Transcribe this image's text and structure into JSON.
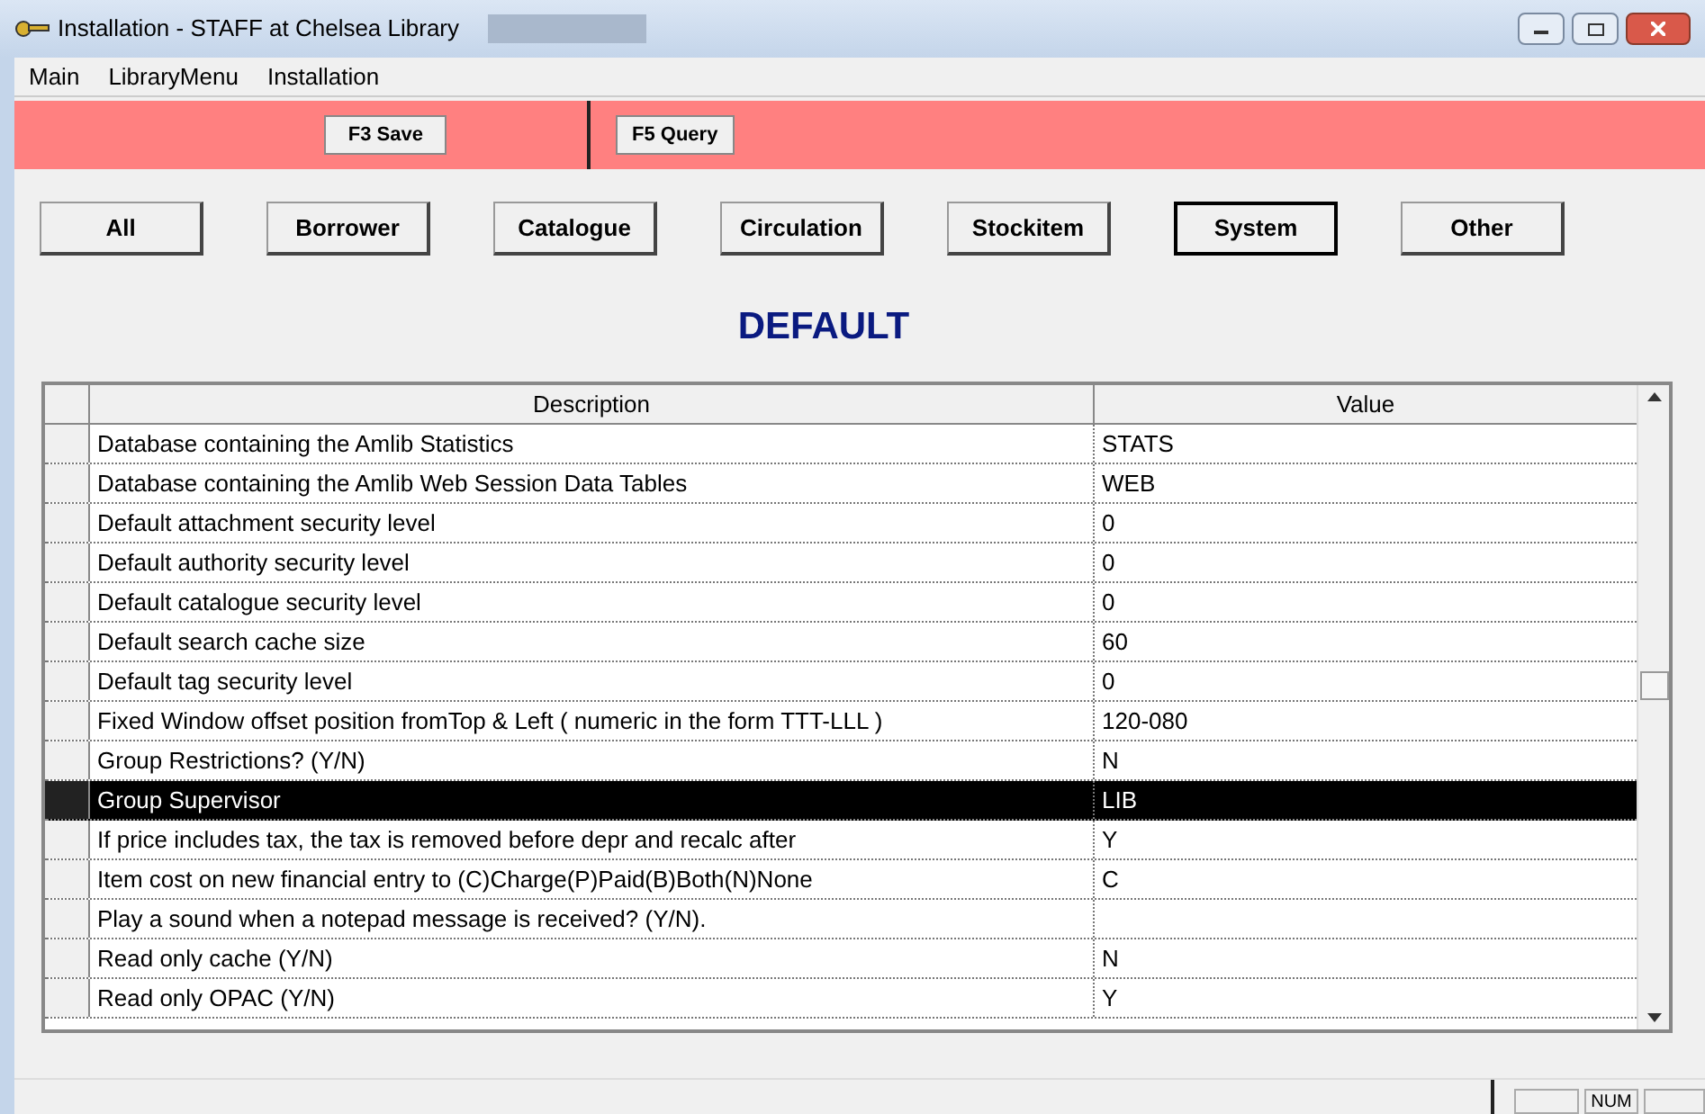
{
  "window": {
    "title": "Installation - STAFF at Chelsea Library"
  },
  "menu": [
    "Main",
    "LibraryMenu",
    "Installation"
  ],
  "toolbar": [
    "F3 Save",
    "F5 Query"
  ],
  "categories": [
    {
      "label": "All",
      "selected": false
    },
    {
      "label": "Borrower",
      "selected": false
    },
    {
      "label": "Catalogue",
      "selected": false
    },
    {
      "label": "Circulation",
      "selected": false
    },
    {
      "label": "Stockitem",
      "selected": false
    },
    {
      "label": "System",
      "selected": true
    },
    {
      "label": "Other",
      "selected": false
    }
  ],
  "heading": "DEFAULT",
  "table": {
    "columns": [
      "Description",
      "Value"
    ],
    "rows": [
      {
        "description": "Database containing the Amlib Statistics",
        "value": "STATS",
        "selected": false
      },
      {
        "description": "Database containing the Amlib Web Session Data Tables",
        "value": "WEB",
        "selected": false
      },
      {
        "description": "Default attachment security level",
        "value": "0",
        "selected": false
      },
      {
        "description": "Default authority security level",
        "value": "0",
        "selected": false
      },
      {
        "description": "Default catalogue security level",
        "value": "0",
        "selected": false
      },
      {
        "description": "Default search cache size",
        "value": "60",
        "selected": false
      },
      {
        "description": "Default tag security level",
        "value": "0",
        "selected": false
      },
      {
        "description": "Fixed Window offset position fromTop & Left ( numeric in the form TTT-LLL )",
        "value": "120-080",
        "selected": false
      },
      {
        "description": "Group Restrictions? (Y/N)",
        "value": "N",
        "selected": false
      },
      {
        "description": "Group Supervisor",
        "value": "LIB",
        "selected": true
      },
      {
        "description": "If price includes tax, the tax is removed before depr and recalc after",
        "value": "Y",
        "selected": false
      },
      {
        "description": "Item cost on new financial entry to (C)Charge(P)Paid(B)Both(N)None",
        "value": "C",
        "selected": false
      },
      {
        "description": "Play a sound when a notepad message is received? (Y/N).",
        "selected": false
      },
      {
        "description": "Read only cache (Y/N)",
        "value": "N",
        "selected": false
      },
      {
        "description": "Read only OPAC (Y/N)",
        "value": "Y",
        "selected": false
      }
    ]
  },
  "status_bar": {
    "indicator": "NUM"
  }
}
